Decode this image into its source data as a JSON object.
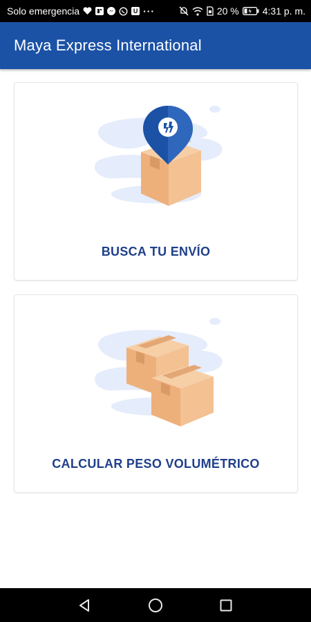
{
  "status_bar": {
    "carrier_text": "Solo emergencia",
    "app_icons": [
      "heart-icon",
      "news-icon",
      "messenger-icon",
      "whatsapp-icon",
      "app-u-icon"
    ],
    "app_u_letter": "U",
    "more_indicator": "···",
    "battery_percent": "20 %",
    "time": "4:31 p. m."
  },
  "appbar": {
    "title": "Maya Express International"
  },
  "cards": [
    {
      "label": "BUSCA TU ENVÍO",
      "icon": "package-location-icon"
    },
    {
      "label": "CALCULAR PESO VOLUMÉTRICO",
      "icon": "packages-icon"
    }
  ],
  "navbar": {
    "buttons": [
      "back-icon",
      "home-icon",
      "recents-icon"
    ]
  },
  "colors": {
    "primary": "#1b52a6",
    "label": "#1f3f8c",
    "box": "#f0b98a",
    "blob": "#e5ecfb"
  }
}
